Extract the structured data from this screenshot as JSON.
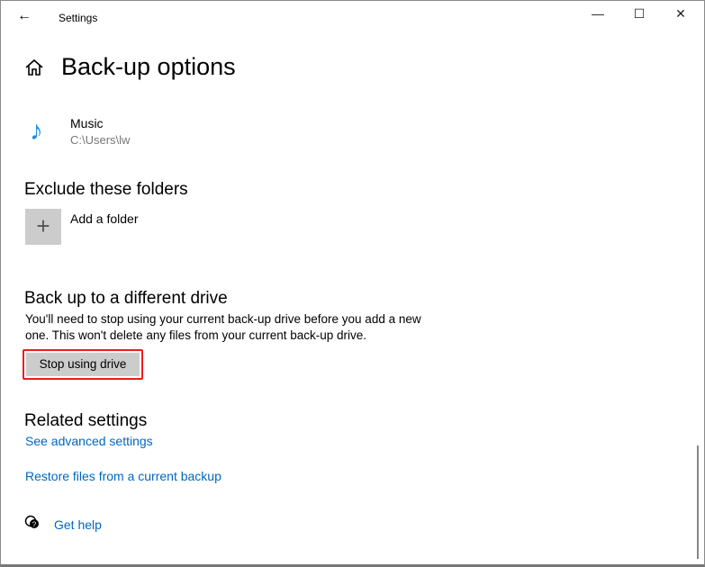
{
  "titlebar": {
    "title": "Settings",
    "back": "←",
    "minimize": "—",
    "maximize": "☐",
    "close": "✕"
  },
  "page_title": "Back-up options",
  "folder": {
    "name": "Music",
    "path": "C:\\Users\\lw"
  },
  "exclude": {
    "heading": "Exclude these folders",
    "add_label": "Add a folder",
    "add_icon": "+"
  },
  "different_drive": {
    "heading": "Back up to a different drive",
    "description": "You'll need to stop using your current back-up drive before you add a new one. This won't delete any files from your current back-up drive.",
    "button": "Stop using drive"
  },
  "related": {
    "heading": "Related settings",
    "links": [
      "See advanced settings",
      "Restore files from a current backup"
    ]
  },
  "help": {
    "label": "Get help"
  },
  "colors": {
    "accent": "#0067c0",
    "highlight": "#ee1c1c",
    "music_icon": "#1a8fe8"
  }
}
